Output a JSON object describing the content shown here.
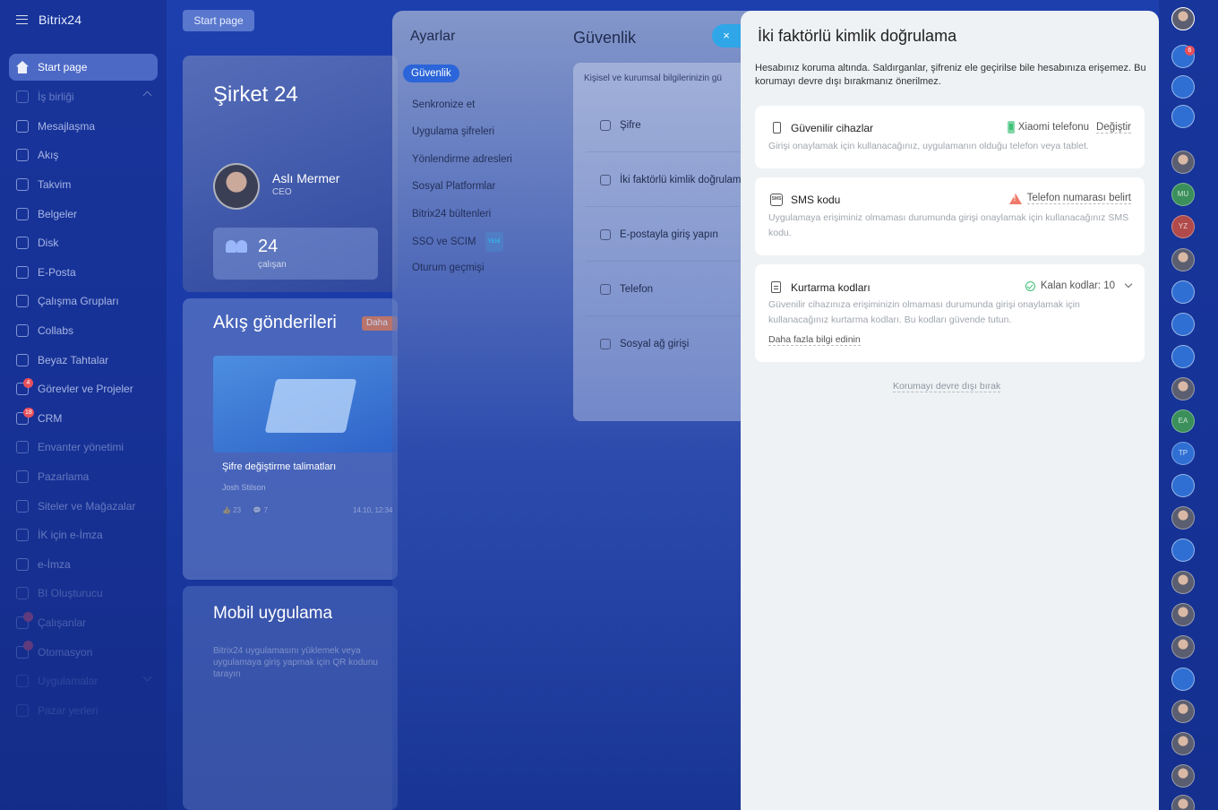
{
  "app": {
    "logo": "Bitrix24",
    "start_button": "Start page"
  },
  "sidebar": {
    "items": [
      {
        "label": "Start page",
        "icon": "home-icon",
        "active": true
      },
      {
        "label": "İş birliği",
        "icon": "collab-icon",
        "chevron": "up"
      },
      {
        "label": "Mesajlaşma",
        "icon": "chat-icon"
      },
      {
        "label": "Akış",
        "icon": "feed-icon"
      },
      {
        "label": "Takvim",
        "icon": "calendar-icon"
      },
      {
        "label": "Belgeler",
        "icon": "documents-icon"
      },
      {
        "label": "Disk",
        "icon": "disk-icon"
      },
      {
        "label": "E-Posta",
        "icon": "mail-icon"
      },
      {
        "label": "Çalışma Grupları",
        "icon": "groups-icon"
      },
      {
        "label": "Collabs",
        "icon": "collabs-icon"
      },
      {
        "label": "Beyaz Tahtalar",
        "icon": "whiteboard-icon"
      },
      {
        "label": "Görevler ve Projeler",
        "icon": "tasks-icon",
        "badge": "4"
      },
      {
        "label": "CRM",
        "icon": "crm-icon",
        "badge": "18"
      },
      {
        "label": "Envanter yönetimi",
        "icon": "inventory-icon"
      },
      {
        "label": "Pazarlama",
        "icon": "marketing-icon"
      },
      {
        "label": "Siteler ve Mağazalar",
        "icon": "sites-icon"
      },
      {
        "label": "İK için e-İmza",
        "icon": "hr-sign-icon"
      },
      {
        "label": "e-İmza",
        "icon": "sign-icon"
      },
      {
        "label": "BI Oluşturucu",
        "icon": "bi-icon"
      },
      {
        "label": "Çalışanlar",
        "icon": "employees-icon",
        "badge": ""
      },
      {
        "label": "Otomasyon",
        "icon": "automation-icon",
        "badge": ""
      },
      {
        "label": "Uygulamalar",
        "icon": "apps-icon",
        "chevron": "down"
      },
      {
        "label": "Pazar yerleri",
        "icon": "market-icon"
      }
    ]
  },
  "background": {
    "company": {
      "title": "Şirket 24",
      "person_name": "Aslı Mermer",
      "person_role": "CEO",
      "employees_count": "24",
      "employees_label": "çalışan"
    },
    "feed": {
      "title": "Akış gönderileri",
      "tag": "Daha",
      "post_title": "Şifre değiştirme talimatları",
      "author": "Josh Stilson",
      "likes": "23",
      "comments": "7",
      "date": "14.10, 12:34"
    },
    "mobile": {
      "title": "Mobil uygulama",
      "description": "Bitrix24 uygulamasını yüklemek veya uygulamaya giriş yapmak için QR kodunu tarayın"
    }
  },
  "settings": {
    "title": "Ayarlar",
    "menu": [
      {
        "label": "Güvenlik",
        "active": true
      },
      {
        "label": "Senkronize et"
      },
      {
        "label": "Uygulama şifreleri"
      },
      {
        "label": "Yönlendirme adresleri"
      },
      {
        "label": "Sosyal Platformlar"
      },
      {
        "label": "Bitrix24 bültenleri"
      },
      {
        "label": "SSO ve SCIM",
        "tag": "YENİ"
      },
      {
        "label": "Oturum geçmişi"
      }
    ],
    "section_title": "Güvenlik",
    "section_intro": "Kişisel ve kurumsal bilgilerinizin gü",
    "rows": [
      {
        "label": "Şifre",
        "icon": "lock-icon"
      },
      {
        "label": "İki faktörlü kimlik doğrulam",
        "icon": "shield-icon"
      },
      {
        "label": "E-postayla giriş yapın",
        "icon": "mail-icon"
      },
      {
        "label": "Telefon",
        "icon": "phone-icon"
      },
      {
        "label": "Sosyal ağ girişi",
        "icon": "grid-icon"
      }
    ],
    "close_label": "×"
  },
  "twofa": {
    "title": "İki faktörlü kimlik doğrulama",
    "description": "Hesabınız koruma altında. Saldırganlar, şifreniz ele geçirilse bile hesabınıza erişemez. Bu korumayı devre dışı bırakmanız önerilmez.",
    "devices": {
      "title": "Güvenilir cihazlar",
      "device_name": "Xiaomi telefonu",
      "change_label": "Değiştir",
      "description": "Girişi onaylamak için kullanacağınız, uygulamanın olduğu telefon veya tablet."
    },
    "sms": {
      "title": "SMS kodu",
      "status": "Telefon numarası belirt",
      "description": "Uygulamaya erişiminiz olmaması durumunda girişi onaylamak için kullanacağınız SMS kodu."
    },
    "recovery": {
      "title": "Kurtarma kodları",
      "status": "Kalan kodlar: 10",
      "description": "Güvenilir cihazınıza erişiminizin olmaması durumunda girişi onaylamak için kullanacağınız kurtarma kodları. Bu kodları güvende tutun.",
      "link": "Daha fazla bilgi edinin"
    },
    "disable_link": "Korumayı devre dışı bırak"
  },
  "rail": {
    "notifications_count": "6",
    "initials": [
      "MU",
      "YZ",
      "EA",
      "TP"
    ]
  },
  "colors": {
    "accent": "#2b65d9",
    "close_button": "#2fa6e8",
    "success": "#3fbf77",
    "warning": "#f07a6a"
  }
}
